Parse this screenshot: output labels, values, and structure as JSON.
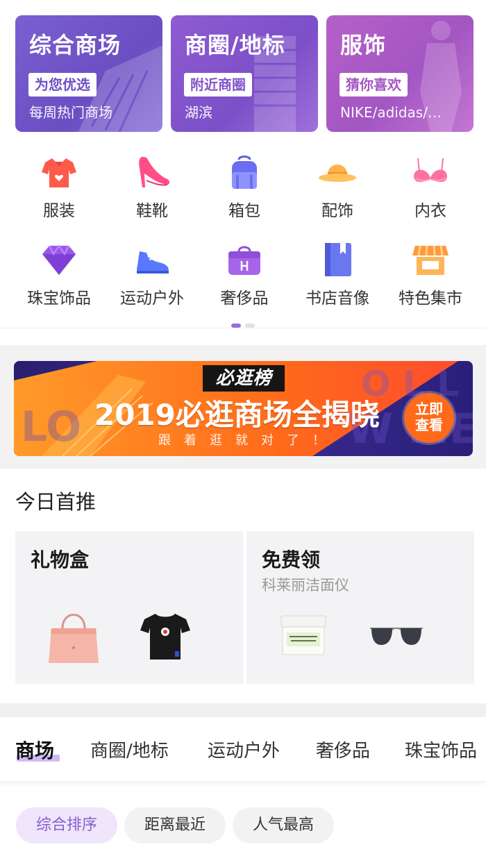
{
  "top_cards": [
    {
      "title": "综合商场",
      "tag": "为您优选",
      "subtitle": "每周热门商场"
    },
    {
      "title": "商圈/地标",
      "tag": "附近商圈",
      "subtitle": "湖滨"
    },
    {
      "title": "服饰",
      "tag": "猜你喜欢",
      "subtitle": "NIKE/adidas/…"
    }
  ],
  "categories": [
    {
      "label": "服装",
      "icon": "shirt-icon"
    },
    {
      "label": "鞋靴",
      "icon": "high-heel-icon"
    },
    {
      "label": "箱包",
      "icon": "backpack-icon"
    },
    {
      "label": "配饰",
      "icon": "hat-icon"
    },
    {
      "label": "内衣",
      "icon": "bra-icon"
    },
    {
      "label": "珠宝饰品",
      "icon": "diamond-icon"
    },
    {
      "label": "运动户外",
      "icon": "sneaker-icon"
    },
    {
      "label": "奢侈品",
      "icon": "luxury-bag-icon"
    },
    {
      "label": "书店音像",
      "icon": "book-icon"
    },
    {
      "label": "特色集市",
      "icon": "market-stall-icon"
    }
  ],
  "banner": {
    "tag": "必逛榜",
    "title": "2019必逛商场全揭晓",
    "subtitle": "跟着逛就对了！",
    "button": "立即查看"
  },
  "today": {
    "title": "今日首推",
    "cards": [
      {
        "title": "礼物盒",
        "subtitle": ""
      },
      {
        "title": "免费领",
        "subtitle": "科莱丽洁面仪"
      }
    ]
  },
  "tabs": [
    "商场",
    "商圈/地标",
    "运动户外",
    "奢侈品",
    "珠宝饰品"
  ],
  "sort_options": [
    "综合排序",
    "距离最近",
    "人气最高"
  ],
  "colors": {
    "accent_purple": "#8a5cd0",
    "card_purple_1": "#6b4fc2",
    "card_purple_2": "#7c4fc8",
    "card_purple_3": "#a356c2",
    "banner_orange": "#ff6a1a"
  }
}
